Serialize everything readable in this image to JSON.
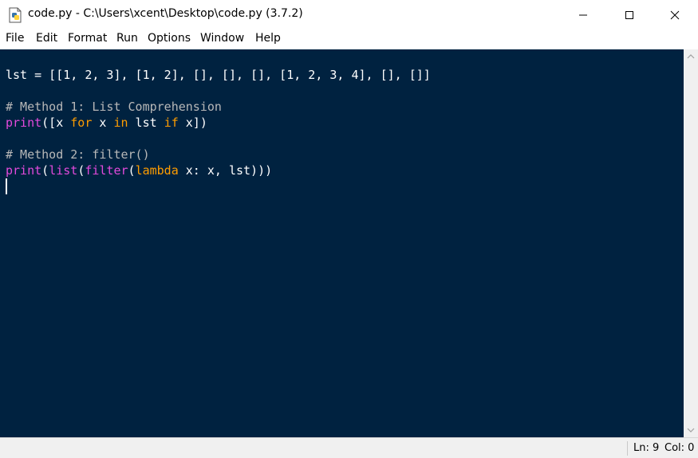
{
  "window": {
    "title": "code.py - C:\\Users\\xcent\\Desktop\\code.py (3.7.2)",
    "app_icon": "python-file-icon",
    "controls": [
      "minimize-icon",
      "maximize-icon",
      "close-icon"
    ]
  },
  "menu": {
    "items": [
      "File",
      "Edit",
      "Format",
      "Run",
      "Options",
      "Window",
      "Help"
    ]
  },
  "editor": {
    "background": "#002240",
    "colors": {
      "text": "#ffffff",
      "keyword": "#ff9d00",
      "builtin": "#e34adc",
      "comment": "#b8b8b8"
    },
    "lines": [
      [
        {
          "t": "lst = [[1, 2, 3], [1, 2], [], [], [], [1, 2, 3, 4], [], []]",
          "c": ""
        }
      ],
      [],
      [
        {
          "t": "# Method 1: List Comprehension",
          "c": "cm"
        }
      ],
      [
        {
          "t": "print",
          "c": "bi"
        },
        {
          "t": "([x ",
          "c": ""
        },
        {
          "t": "for",
          "c": "kw"
        },
        {
          "t": " x ",
          "c": ""
        },
        {
          "t": "in",
          "c": "kw"
        },
        {
          "t": " lst ",
          "c": ""
        },
        {
          "t": "if",
          "c": "kw"
        },
        {
          "t": " x])",
          "c": ""
        }
      ],
      [],
      [
        {
          "t": "# Method 2: filter()",
          "c": "cm"
        }
      ],
      [
        {
          "t": "print",
          "c": "bi"
        },
        {
          "t": "(",
          "c": ""
        },
        {
          "t": "list",
          "c": "bi"
        },
        {
          "t": "(",
          "c": ""
        },
        {
          "t": "filter",
          "c": "bi"
        },
        {
          "t": "(",
          "c": ""
        },
        {
          "t": "lambda",
          "c": "kw"
        },
        {
          "t": " x: x, lst)))",
          "c": ""
        }
      ]
    ]
  },
  "status": {
    "line": "Ln: 9",
    "col": "Col: 0"
  }
}
